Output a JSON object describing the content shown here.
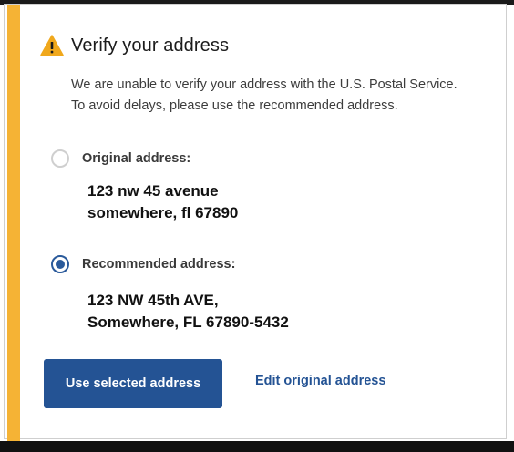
{
  "alert": {
    "icon": "warning-icon",
    "accent_color": "#f5b335",
    "heading": "Verify your address",
    "message": "We are unable to verify your address with the U.S. Postal Service. To avoid delays, please use the recommended address."
  },
  "options": {
    "original": {
      "label": "Original address:",
      "selected": false,
      "line1": "123 nw 45 avenue",
      "line2": "somewhere, fl 67890"
    },
    "recommended": {
      "label": "Recommended address:",
      "selected": true,
      "line1": "123 NW 45th AVE,",
      "line2": "Somewhere, FL 67890-5432"
    }
  },
  "actions": {
    "primary_label": "Use selected address",
    "secondary_label": "Edit original address",
    "primary_color": "#245394"
  }
}
